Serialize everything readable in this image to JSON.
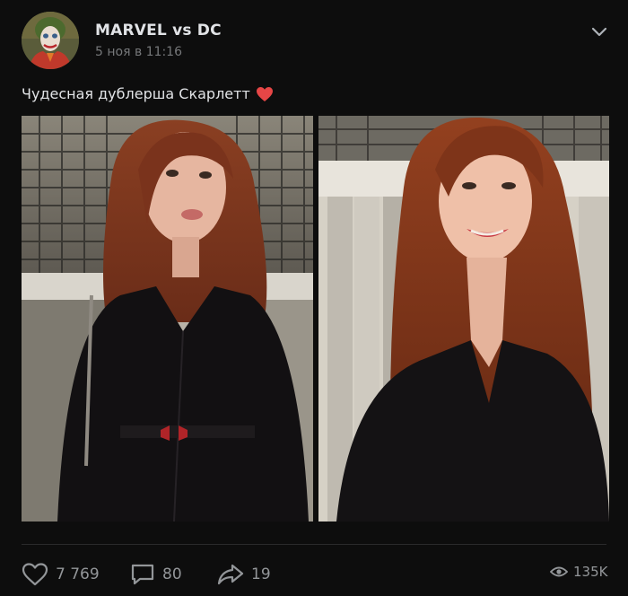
{
  "post": {
    "author_name": "MARVEL vs DC",
    "date": "5 ноя в 11:16",
    "text": "Чудесная дублерша Скарлетт",
    "text_emoji": "heart-emoji",
    "photos": [
      {
        "name": "photo-left",
        "description_icon": "photo"
      },
      {
        "name": "photo-right",
        "description_icon": "photo"
      }
    ]
  },
  "actions": {
    "likes": "7 769",
    "comments": "80",
    "shares": "19",
    "views": "135K"
  },
  "colors": {
    "background": "#0d0d0d",
    "text": "#e1e3e6",
    "secondary": "#939699",
    "heart": "#e64646"
  }
}
